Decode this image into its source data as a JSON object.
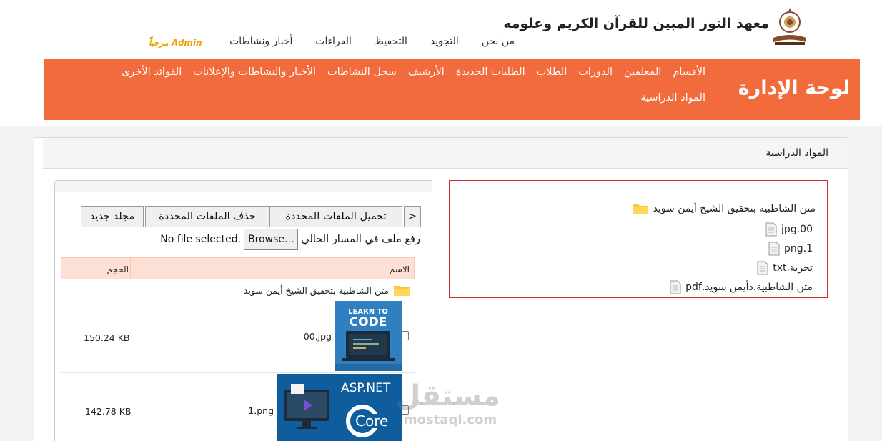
{
  "site": {
    "title": "معهد النور المبين للقرآن الكريم وعلومه",
    "nav": [
      "أخبار ونشاطات",
      "القراءات",
      "التحفيظ",
      "التجويد",
      "من نحن"
    ],
    "welcome": "مرحباً Admin"
  },
  "admin": {
    "title": "لوحة الإدارة",
    "menu": [
      "الأقسام",
      "المعلمين",
      "الدورات",
      "الطلاب",
      "الطلبات الجديدة",
      "الأرشيف",
      "سجل النشاطات",
      "الأخبار والنشاطات والإعلانات",
      "الفوائد الأخرى",
      "المواد الدراسية"
    ]
  },
  "card": {
    "title": "المواد الدراسية"
  },
  "tree": {
    "folder": "متن الشاطبية بتحقيق الشيخ أيمن سويد",
    "files": [
      "00.jpg",
      "1.png",
      "تجربة.txt",
      "متن الشاطبية.دأيمن سويد.pdf"
    ]
  },
  "filemanager": {
    "buttons": {
      "back": "<",
      "upload_selected": "تحميل الملفات المحددة",
      "delete_selected": "حذف الملفات المحددة",
      "new_folder": "مجلد جديد"
    },
    "upload_label": "رفع ملف في المسار الحالي",
    "browse_label": "Browse...",
    "no_file": "No file selected.",
    "columns": {
      "name": "الاسم",
      "size": "الحجم"
    },
    "folder_row": "متن الشاطبية بتحقيق الشيخ أيمن سويد",
    "rows": [
      {
        "name": "00.jpg",
        "size": "150.24 KB",
        "thumb_lines": [
          "LEARN TO",
          "CODE"
        ]
      },
      {
        "name": "1.png",
        "size": "142.78 KB",
        "thumb_lines": [
          "ASP.NET",
          "Core"
        ]
      }
    ]
  },
  "watermark": {
    "ar": "مستقل",
    "en": "mostaql.com"
  },
  "colors": {
    "orange": "#f26b3d",
    "welcome": "#f0a000",
    "table_head": "#fde0d3",
    "tree_border": "#c9302c"
  }
}
